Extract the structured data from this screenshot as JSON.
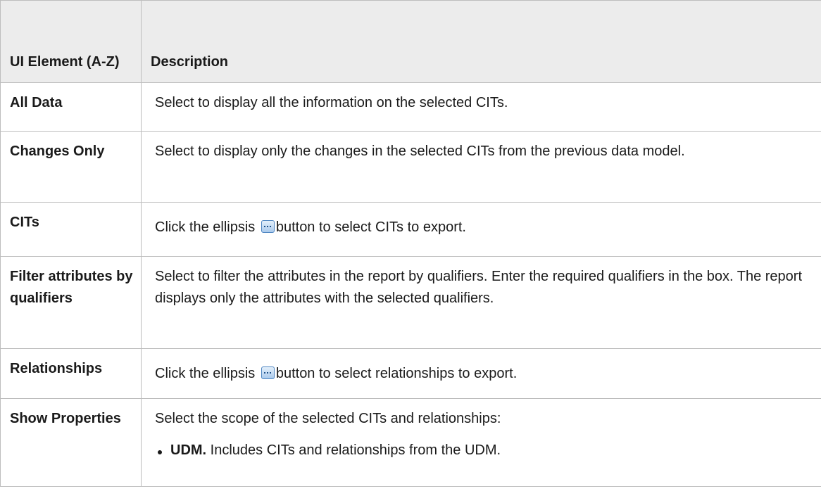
{
  "table": {
    "headers": {
      "element": "UI Element (A-Z)",
      "description": "Description"
    },
    "rows": [
      {
        "element": "All Data",
        "description": "Select to display all the information on the selected CITs."
      },
      {
        "element": "Changes Only",
        "description": "Select to display only the changes in the selected CITs from the previous data model."
      },
      {
        "element": "CITs",
        "description_before": "Click the ellipsis",
        "icon": "ellipsis-button-icon",
        "description_after": "button to select CITs to export."
      },
      {
        "element": "Filter attributes by qualifiers",
        "description": "Select to filter the attributes in the report by qualifiers. Enter the required qualifiers in the box. The report displays only the attributes with the selected qualifiers."
      },
      {
        "element": "Relationships",
        "description_before": "Click the ellipsis",
        "icon": "ellipsis-button-icon",
        "description_after": "button to select relationships to export."
      },
      {
        "element": "Show Properties",
        "description": "Select the scope of the selected CITs and relationships:",
        "bullets": [
          {
            "term": "UDM.",
            "text": "Includes CITs and relationships from the UDM."
          }
        ]
      }
    ]
  }
}
